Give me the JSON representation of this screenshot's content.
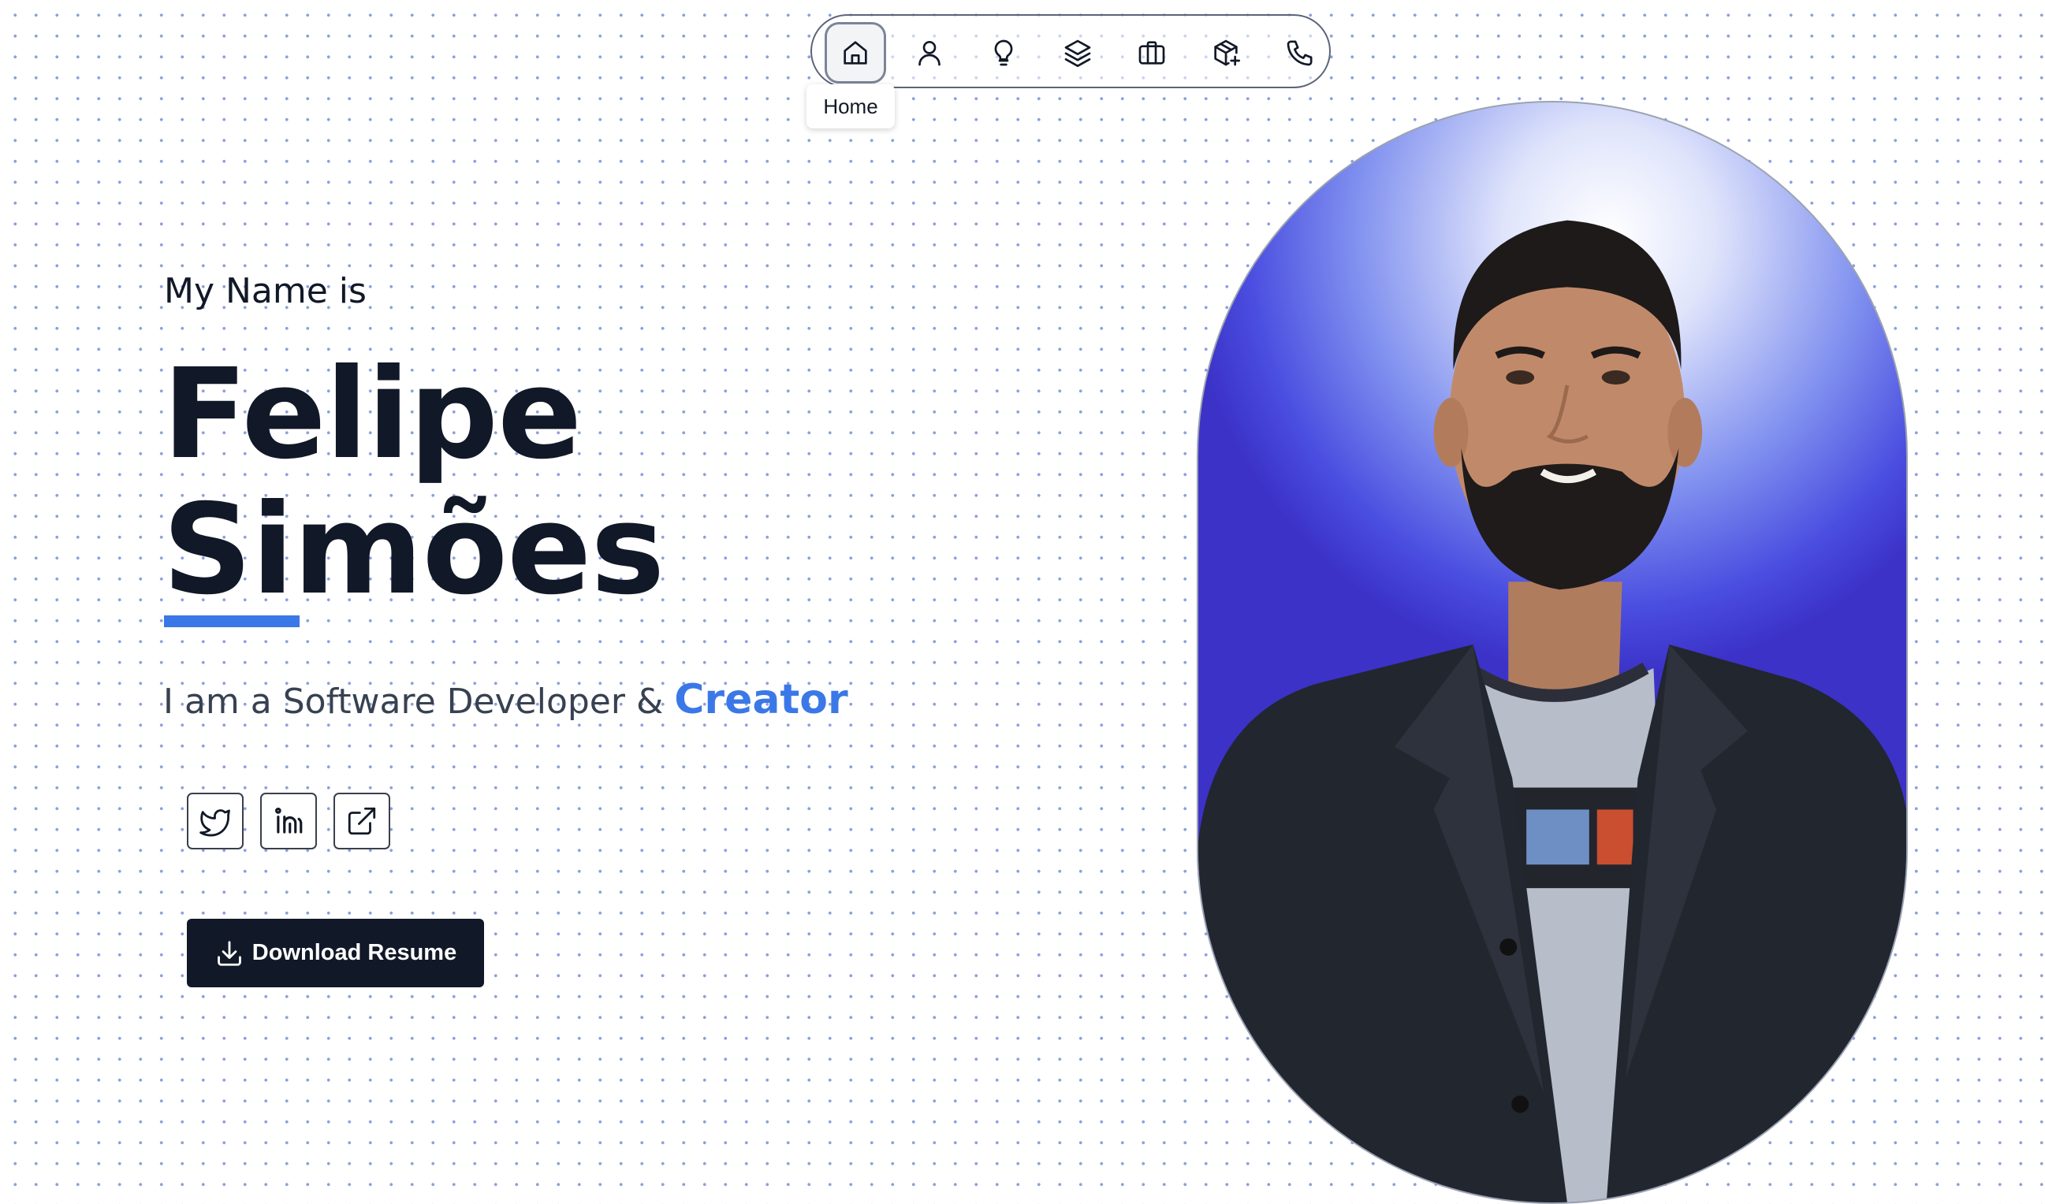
{
  "nav": {
    "items": [
      {
        "icon": "home-icon",
        "active": true
      },
      {
        "icon": "user-icon",
        "active": false
      },
      {
        "icon": "lightbulb-icon",
        "active": false
      },
      {
        "icon": "layers-icon",
        "active": false
      },
      {
        "icon": "briefcase-icon",
        "active": false
      },
      {
        "icon": "package-plus-icon",
        "active": false
      },
      {
        "icon": "phone-icon",
        "active": false
      }
    ],
    "tooltip": "Home"
  },
  "hero": {
    "intro": "My Name is",
    "first_name": "Felipe",
    "last_name": "Simões",
    "tagline_prefix": "I am a Software Developer &",
    "tagline_accent": "Creator"
  },
  "social": [
    {
      "icon": "twitter-icon"
    },
    {
      "icon": "linkedin-icon"
    },
    {
      "icon": "external-link-icon"
    }
  ],
  "download": {
    "label": "Download Resume",
    "icon": "download-icon"
  },
  "colors": {
    "accent": "#3b78e7",
    "dark": "#111827",
    "dot_grid": "#8a9fe0"
  }
}
